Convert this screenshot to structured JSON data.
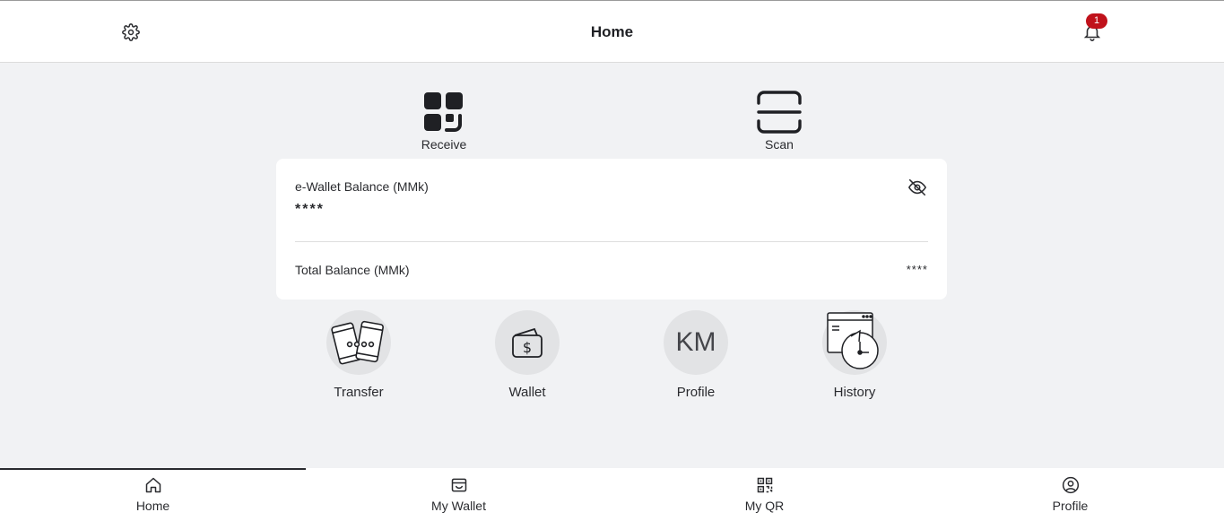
{
  "header": {
    "title": "Home",
    "notification_count": "1"
  },
  "quick_actions": [
    {
      "label": "Receive",
      "icon": "qr-receive-icon"
    },
    {
      "label": "Scan",
      "icon": "scan-icon"
    }
  ],
  "balance_card": {
    "wallet_label": "e-Wallet Balance (MMk)",
    "wallet_value": "****",
    "total_label": "Total Balance (MMk)",
    "total_value": "****",
    "visibility_icon": "eye-off-icon"
  },
  "actions": [
    {
      "label": "Transfer",
      "icon": "transfer-phones-icon"
    },
    {
      "label": "Wallet",
      "icon": "wallet-dollar-icon"
    },
    {
      "label": "Profile",
      "initials": "KM"
    },
    {
      "label": "History",
      "icon": "history-clock-icon"
    }
  ],
  "bottom_nav": [
    {
      "label": "Home",
      "icon": "home-icon",
      "active": true
    },
    {
      "label": "My Wallet",
      "icon": "wallet-icon"
    },
    {
      "label": "My QR",
      "icon": "qr-icon"
    },
    {
      "label": "Profile",
      "icon": "user-circle-icon"
    }
  ],
  "colors": {
    "background": "#f1f2f4",
    "badge": "#c0121b",
    "text": "#1f2024"
  }
}
